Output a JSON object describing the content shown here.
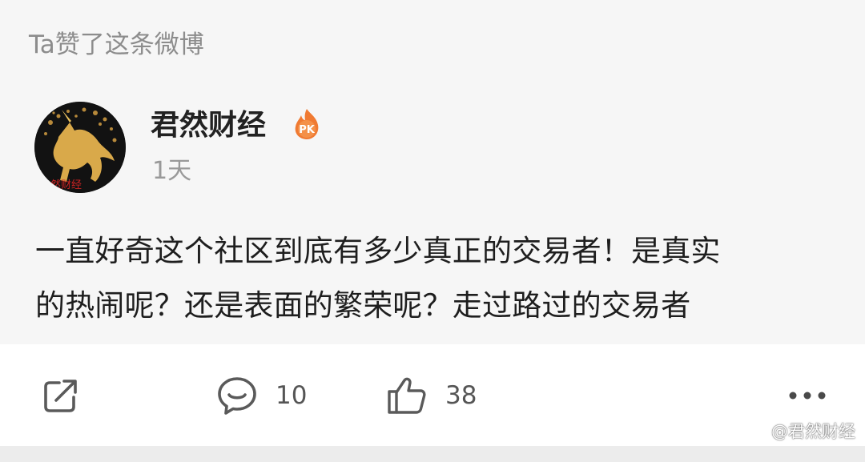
{
  "feed_item": {
    "liked_hint": "Ta赞了这条微博",
    "author": {
      "name": "君然财经",
      "avatar_icon": "gold-unicorn-avatar",
      "badge_icon": "pk-flame-badge",
      "badge_text": "PK",
      "time": "1天"
    },
    "body_lines": [
      "一直好奇这个社区到底有多少真正的交易者！是真实",
      "的热闹呢？还是表面的繁荣呢？走过路过的交易者"
    ],
    "actions": {
      "share_icon": "share-icon",
      "comment_icon": "comment-icon",
      "comment_count": "10",
      "like_icon": "thumbs-up-icon",
      "like_count": "38",
      "more_icon": "more-icon"
    }
  },
  "watermark": {
    "text": "@君然财经",
    "icon": "weibo-logo-icon"
  },
  "colors": {
    "card_top_bg": "#f6f6f6",
    "card_bottom_bg": "#ffffff",
    "page_bg": "#ececec",
    "muted_text": "#8c8c8c",
    "body_text": "#1e1e1e",
    "icon_gray": "#5a5a5a",
    "badge_orange": "#f07a32"
  }
}
